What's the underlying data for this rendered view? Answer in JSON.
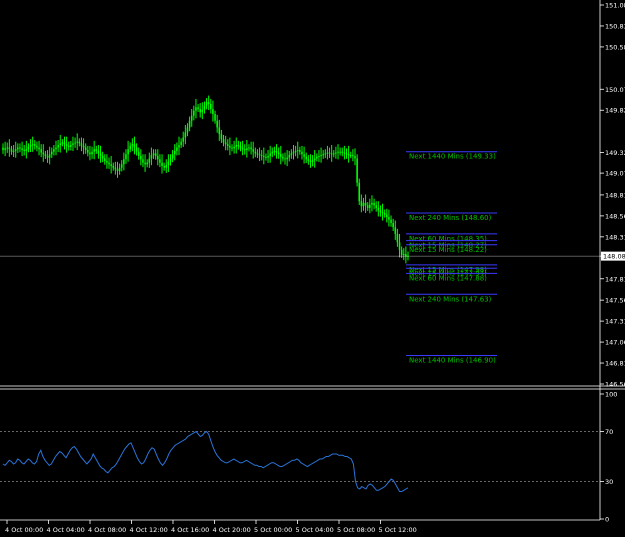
{
  "colors": {
    "background": "#000000",
    "candle": "#00ff00",
    "grid": "#ffffff",
    "axis": "#ffffff",
    "level_line": "#3a3aff",
    "level_label": "#00c000",
    "current_price_line": "#ffffff",
    "rsi_line": "#2a74d8"
  },
  "chart_data": [
    {
      "type": "candlestick",
      "price_axis": {
        "ticks": [
          "151.080",
          "150.830",
          "150.580",
          "150.075",
          "149.825",
          "149.320",
          "149.075",
          "148.815",
          "148.565",
          "148.315",
          "148.085",
          "147.815",
          "147.560",
          "147.310",
          "147.060",
          "146.810",
          "146.560"
        ],
        "current_price": "148.085",
        "range": [
          146.56,
          151.08
        ]
      },
      "time_axis": {
        "ticks": [
          "4 Oct 00:00",
          "4 Oct 04:00",
          "4 Oct 08:00",
          "4 Oct 12:00",
          "4 Oct 16:00",
          "4 Oct 20:00",
          "5 Oct 00:00",
          "5 Oct 04:00",
          "5 Oct 08:00",
          "5 Oct 12:00"
        ]
      },
      "close_series": [
        149.35,
        149.37,
        149.38,
        149.36,
        149.33,
        149.34,
        149.36,
        149.38,
        149.37,
        149.35,
        149.34,
        149.36,
        149.39,
        149.41,
        149.42,
        149.4,
        149.38,
        149.36,
        149.32,
        149.3,
        149.28,
        149.26,
        149.3,
        149.33,
        149.36,
        149.38,
        149.41,
        149.43,
        149.44,
        149.42,
        149.4,
        149.39,
        149.41,
        149.43,
        149.44,
        149.45,
        149.43,
        149.4,
        149.38,
        149.35,
        149.32,
        149.3,
        149.33,
        149.36,
        149.34,
        149.31,
        149.28,
        149.25,
        149.22,
        149.2,
        149.18,
        149.16,
        149.14,
        149.12,
        149.1,
        149.14,
        149.18,
        149.24,
        149.3,
        149.36,
        149.4,
        149.42,
        149.38,
        149.33,
        149.28,
        149.24,
        149.2,
        149.18,
        149.2,
        149.25,
        149.29,
        149.31,
        149.28,
        149.24,
        149.2,
        149.16,
        149.14,
        149.17,
        149.21,
        149.25,
        149.3,
        149.34,
        149.38,
        149.41,
        149.45,
        149.5,
        149.56,
        149.62,
        149.7,
        149.76,
        149.82,
        149.86,
        149.84,
        149.8,
        149.83,
        149.88,
        149.92,
        149.9,
        149.84,
        149.78,
        149.7,
        149.62,
        149.54,
        149.48,
        149.44,
        149.42,
        149.4,
        149.38,
        149.37,
        149.39,
        149.41,
        149.4,
        149.38,
        149.36,
        149.35,
        149.37,
        149.38,
        149.36,
        149.33,
        149.31,
        149.3,
        149.29,
        149.28,
        149.27,
        149.26,
        149.28,
        149.31,
        149.33,
        149.34,
        149.32,
        149.3,
        149.27,
        149.25,
        149.24,
        149.26,
        149.29,
        149.31,
        149.33,
        149.34,
        149.35,
        149.33,
        149.3,
        149.27,
        149.24,
        149.22,
        149.21,
        149.23,
        149.25,
        149.27,
        149.28,
        149.29,
        149.3,
        149.31,
        149.32,
        149.31,
        149.3,
        149.31,
        149.32,
        149.33,
        149.33,
        149.32,
        149.31,
        149.3,
        149.29,
        149.29,
        149.28,
        149.25,
        148.96,
        148.74,
        148.68,
        148.72,
        148.69,
        148.66,
        148.7,
        148.72,
        148.69,
        148.66,
        148.63,
        148.61,
        148.6,
        148.58,
        148.55,
        148.52,
        148.48,
        148.43,
        148.35,
        148.25,
        148.16,
        148.1,
        148.11,
        148.08,
        148.09
      ],
      "levels": [
        {
          "label": "Next 1440 Mins (149.33)",
          "price": 149.33,
          "side": "up"
        },
        {
          "label": "Next 240 Mins (148.60)",
          "price": 148.6,
          "side": "up"
        },
        {
          "label": "Next 60 Mins (148.35)",
          "price": 148.35,
          "side": "up"
        },
        {
          "label": "Next 15 Mins (148.27)",
          "price": 148.27,
          "side": "up"
        },
        {
          "label": "Next 15 Mins (148.22)",
          "price": 148.22,
          "side": "up"
        },
        {
          "label": "Next 15 Mins (147.98)",
          "price": 147.98,
          "side": "down"
        },
        {
          "label": "Next 15 Mins (147.94)",
          "price": 147.94,
          "side": "down"
        },
        {
          "label": "Next 60 Mins (147.88)",
          "price": 147.88,
          "side": "down"
        },
        {
          "label": "Next 240 Mins (147.63)",
          "price": 147.63,
          "side": "down"
        },
        {
          "label": "Next 1440 Mins (146.90)",
          "price": 146.9,
          "side": "down"
        }
      ]
    },
    {
      "type": "line",
      "indicator": "RSI",
      "y_axis": {
        "ticks": [
          "100",
          "70",
          "30",
          "0"
        ],
        "range": [
          0,
          100
        ]
      },
      "levels": [
        70,
        30
      ],
      "values": [
        44,
        43,
        45,
        47,
        46,
        44,
        45,
        48,
        47,
        45,
        44,
        46,
        48,
        47,
        45,
        44,
        46,
        52,
        55,
        50,
        47,
        45,
        43,
        44,
        47,
        50,
        52,
        54,
        53,
        51,
        49,
        52,
        55,
        57,
        58,
        56,
        53,
        50,
        48,
        46,
        44,
        46,
        48,
        52,
        49,
        46,
        43,
        41,
        40,
        38,
        37,
        39,
        41,
        42,
        44,
        47,
        50,
        53,
        56,
        58,
        60,
        61,
        57,
        53,
        49,
        46,
        44,
        45,
        48,
        52,
        55,
        57,
        56,
        52,
        48,
        45,
        43,
        45,
        48,
        52,
        55,
        57,
        59,
        60,
        61,
        62,
        63,
        64,
        66,
        67,
        68,
        69,
        70,
        68,
        66,
        67,
        69,
        70,
        68,
        63,
        58,
        54,
        51,
        49,
        47,
        46,
        45,
        45,
        46,
        47,
        48,
        47,
        46,
        45,
        45,
        46,
        47,
        46,
        45,
        44,
        43,
        43,
        42,
        42,
        41,
        42,
        43,
        44,
        45,
        45,
        44,
        43,
        42,
        42,
        43,
        44,
        45,
        46,
        47,
        47,
        48,
        47,
        45,
        44,
        43,
        42,
        43,
        44,
        45,
        46,
        47,
        48,
        48,
        49,
        50,
        50,
        51,
        52,
        52,
        52,
        51,
        51,
        51,
        50,
        50,
        49,
        48,
        44,
        30,
        25,
        24,
        26,
        25,
        24,
        27,
        28,
        27,
        25,
        23,
        23,
        24,
        25,
        26,
        28,
        30,
        32,
        31,
        28,
        25,
        22,
        22,
        23,
        24,
        25
      ]
    }
  ]
}
